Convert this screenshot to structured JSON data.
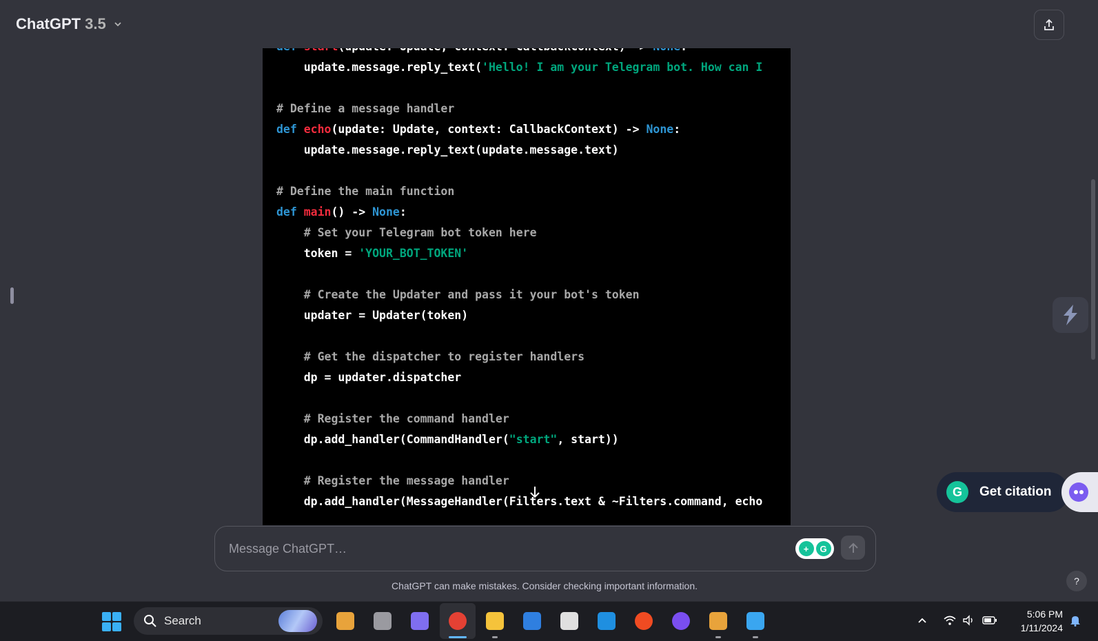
{
  "header": {
    "model_name": "ChatGPT",
    "model_version": "3.5",
    "share_icon": "share-upload-icon"
  },
  "code_lines": [
    {
      "segs": [
        {
          "t": "def ",
          "c": "kw"
        },
        {
          "t": "start",
          "c": "fn"
        },
        {
          "t": "(update: Update, context: CallbackContext) -> ",
          "c": ""
        },
        {
          "t": "None",
          "c": "kw"
        },
        {
          "t": ":",
          "c": ""
        }
      ]
    },
    {
      "segs": [
        {
          "t": "    update.message.reply_text(",
          "c": ""
        },
        {
          "t": "'Hello! I am your Telegram bot. How can I",
          "c": "str"
        }
      ]
    },
    {
      "segs": []
    },
    {
      "segs": [
        {
          "t": "# Define a message handler",
          "c": "cm"
        }
      ]
    },
    {
      "segs": [
        {
          "t": "def ",
          "c": "kw"
        },
        {
          "t": "echo",
          "c": "fn"
        },
        {
          "t": "(update: Update, context: CallbackContext) -> ",
          "c": ""
        },
        {
          "t": "None",
          "c": "kw"
        },
        {
          "t": ":",
          "c": ""
        }
      ]
    },
    {
      "segs": [
        {
          "t": "    update.message.reply_text(update.message.text)",
          "c": ""
        }
      ]
    },
    {
      "segs": []
    },
    {
      "segs": [
        {
          "t": "# Define the main function",
          "c": "cm"
        }
      ]
    },
    {
      "segs": [
        {
          "t": "def ",
          "c": "kw"
        },
        {
          "t": "main",
          "c": "fn"
        },
        {
          "t": "() -> ",
          "c": ""
        },
        {
          "t": "None",
          "c": "kw"
        },
        {
          "t": ":",
          "c": ""
        }
      ]
    },
    {
      "segs": [
        {
          "t": "    ",
          "c": ""
        },
        {
          "t": "# Set your Telegram bot token here",
          "c": "cm"
        }
      ]
    },
    {
      "segs": [
        {
          "t": "    token = ",
          "c": ""
        },
        {
          "t": "'YOUR_BOT_TOKEN'",
          "c": "str"
        }
      ]
    },
    {
      "segs": []
    },
    {
      "segs": [
        {
          "t": "    ",
          "c": ""
        },
        {
          "t": "# Create the Updater and pass it your bot's token",
          "c": "cm"
        }
      ]
    },
    {
      "segs": [
        {
          "t": "    updater = Updater(token)",
          "c": ""
        }
      ]
    },
    {
      "segs": []
    },
    {
      "segs": [
        {
          "t": "    ",
          "c": ""
        },
        {
          "t": "# Get the dispatcher to register handlers",
          "c": "cm"
        }
      ]
    },
    {
      "segs": [
        {
          "t": "    dp = updater.dispatcher",
          "c": ""
        }
      ]
    },
    {
      "segs": []
    },
    {
      "segs": [
        {
          "t": "    ",
          "c": ""
        },
        {
          "t": "# Register the command handler",
          "c": "cm"
        }
      ]
    },
    {
      "segs": [
        {
          "t": "    dp.add_handler(CommandHandler(",
          "c": ""
        },
        {
          "t": "\"start\"",
          "c": "str"
        },
        {
          "t": ", start))",
          "c": ""
        }
      ]
    },
    {
      "segs": []
    },
    {
      "segs": [
        {
          "t": "    ",
          "c": ""
        },
        {
          "t": "# Register the message handler",
          "c": "cm"
        }
      ]
    },
    {
      "segs": [
        {
          "t": "    dp.add_handler(MessageHandler(Filters.text & ~Filters.command, echo",
          "c": ""
        }
      ]
    }
  ],
  "citation": {
    "label": "Get citation",
    "icon": "grammarly-icon"
  },
  "composer": {
    "placeholder": "Message ChatGPT…",
    "send_icon": "arrow-up-icon"
  },
  "disclaimer": "ChatGPT can make mistakes. Consider checking important information.",
  "help_label": "?",
  "taskbar": {
    "search_label": "Search",
    "apps": [
      {
        "name": "copilot-pre-app",
        "icon": "copilot-icon",
        "color": "#e8a33b"
      },
      {
        "name": "task-view-app",
        "icon": "task-view-icon",
        "color": "#9a9aa0"
      },
      {
        "name": "copilot-app",
        "icon": "copilot-hex-icon",
        "color": "#7f6ef0"
      },
      {
        "name": "chrome-app",
        "icon": "chrome-icon",
        "color": "#e44134"
      },
      {
        "name": "file-explorer-app",
        "icon": "folder-icon",
        "color": "#f5c33b"
      },
      {
        "name": "todo-app",
        "icon": "checkmark-icon",
        "color": "#2f7fe0"
      },
      {
        "name": "snipping-tool-app",
        "icon": "snip-icon",
        "color": "#e0e0e0"
      },
      {
        "name": "vscode-app",
        "icon": "vscode-icon",
        "color": "#1f8fe0"
      },
      {
        "name": "brave-app",
        "icon": "brave-icon",
        "color": "#f04b22"
      },
      {
        "name": "firefox-app",
        "icon": "firefox-icon",
        "color": "#7a4ef0"
      },
      {
        "name": "git-app",
        "icon": "git-icon",
        "color": "#e8a33b"
      },
      {
        "name": "photos-app",
        "icon": "photos-icon",
        "color": "#3aa6f0"
      }
    ],
    "clock_time": "5:06 PM",
    "clock_date": "1/11/2024"
  }
}
